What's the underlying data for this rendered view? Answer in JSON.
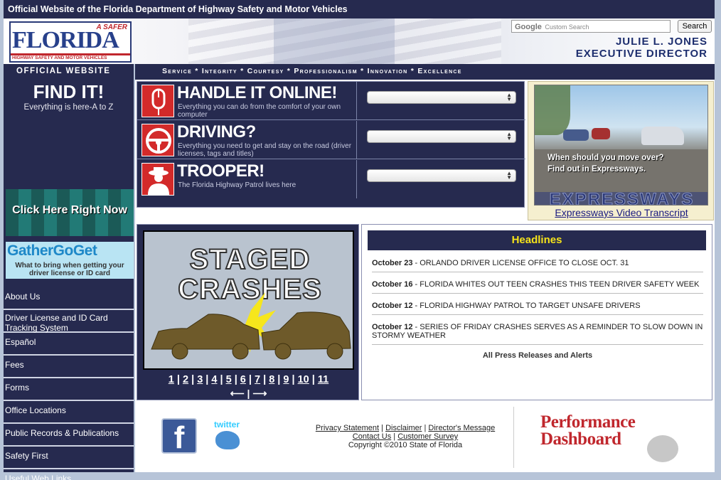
{
  "topbar": {
    "title": "Official Website of the Florida Department of Highway Safety and Motor Vehicles"
  },
  "header": {
    "logo": {
      "tagline": "A SAFER",
      "name": "FLORIDA",
      "subtitle": "HIGHWAY SAFETY AND MOTOR VEHICLES"
    },
    "search": {
      "brand": "Google",
      "placeholder": "Custom Search",
      "button": "Search"
    },
    "executive": {
      "name": "JULIE L. JONES",
      "title": "EXECUTIVE DIRECTOR"
    }
  },
  "sidebar": {
    "official": "OFFICIAL WEBSITE",
    "findit": {
      "title": "FIND IT!",
      "subtitle": "Everything is here-A to Z"
    },
    "clickhere": "Click Here Right Now",
    "gather": {
      "title": "GatherGoGet",
      "subtitle": "What to bring when getting your driver license or ID card"
    },
    "nav": [
      "About Us",
      "Driver License and ID Card Tracking System",
      "Español",
      "Fees",
      "Forms",
      "Office Locations",
      "Public Records & Publications",
      "Safety First",
      "Useful Web Links"
    ]
  },
  "tagline": "Service * Integrity * Courtesy * Professionalism * Innovation * Excellence",
  "tasks": [
    {
      "title": "HANDLE IT ONLINE!",
      "desc": "Everything you can do from the comfort of your own computer",
      "icon": "mouse-icon"
    },
    {
      "title": "DRIVING?",
      "desc": "Everything you need to get and stay on the road (driver licenses, tags and titles)",
      "icon": "steering-wheel-icon"
    },
    {
      "title": "TROOPER!",
      "desc": "The Florida Highway Patrol lives here",
      "icon": "trooper-icon"
    }
  ],
  "video": {
    "caption_line1": "When should you move over?",
    "caption_line2": "Find out in Expressways.",
    "brand": "EXPRESSWAYS",
    "link": "Expressways Video Transcript"
  },
  "staged": {
    "title_line1": "STAGED",
    "title_line2": "CRASHES",
    "pages": [
      "1",
      "2",
      "3",
      "4",
      "5",
      "6",
      "7",
      "8",
      "9",
      "10",
      "11"
    ]
  },
  "headlines": {
    "title": "Headlines",
    "items": [
      {
        "date": "October 23",
        "text": "ORLANDO DRIVER LICENSE OFFICE TO CLOSE OCT. 31"
      },
      {
        "date": "October 16",
        "text": "FLORIDA WHITES OUT TEEN CRASHES THIS TEEN DRIVER SAFETY WEEK"
      },
      {
        "date": "October 12",
        "text": "FLORIDA HIGHWAY PATROL TO TARGET UNSAFE DRIVERS"
      },
      {
        "date": "October 12",
        "text": "SERIES OF FRIDAY CRASHES SERVES AS A REMINDER TO SLOW DOWN IN STORMY WEATHER"
      }
    ],
    "all": "All Press Releases and Alerts"
  },
  "footer": {
    "facebook": "f",
    "twitter": "twitter",
    "links_row1": [
      "Privacy Statement",
      "Disclaimer",
      "Director's Message"
    ],
    "links_row2": [
      "Contact Us",
      "Customer Survey"
    ],
    "copyright": "Copyright ©2010 State of Florida",
    "perf_line1": "Performance",
    "perf_line2": "Dashboard"
  }
}
